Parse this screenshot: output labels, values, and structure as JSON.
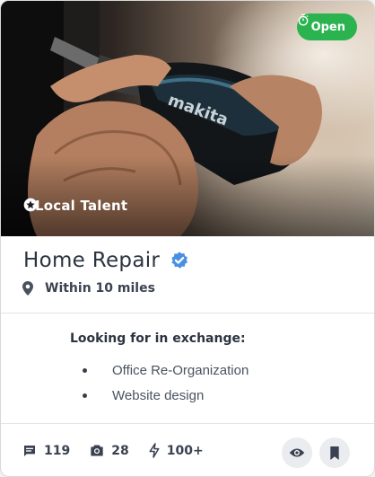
{
  "hero": {
    "status_badge": "Open",
    "category_label": "Local Talent",
    "icons": {
      "status": "stopwatch-icon",
      "category": "star-circle-icon"
    }
  },
  "listing": {
    "title": "Home Repair",
    "verified_icon": "verified-check-icon",
    "location": "Within 10 miles",
    "location_icon": "map-pin-icon"
  },
  "exchange": {
    "heading": "Looking for in exchange:",
    "items": [
      "Office Re-Organization",
      "Website design"
    ]
  },
  "stats": {
    "comments": "119",
    "photos": "28",
    "boosts": "100+",
    "icons": {
      "comments": "comment-icon",
      "photos": "camera-icon",
      "boosts": "lightning-icon"
    }
  },
  "actions": {
    "view_icon": "eye-icon",
    "save_icon": "bookmark-icon"
  },
  "colors": {
    "badge_green": "#2bb34f",
    "verified_blue": "#4a90e2",
    "text_dark": "#2c3440",
    "action_bg": "#eaecef"
  }
}
